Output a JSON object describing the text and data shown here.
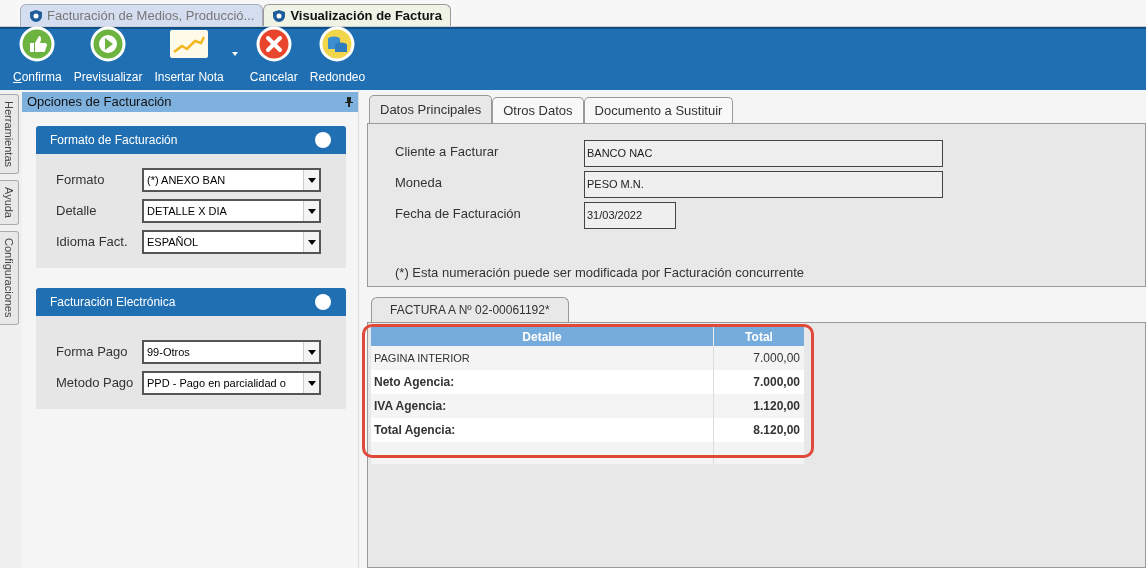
{
  "document_tabs": [
    {
      "label": "Facturación de Medios, Producció...",
      "selected": false
    },
    {
      "label": "Visualización de Factura",
      "selected": true
    }
  ],
  "toolbar": [
    {
      "kind": "confirm",
      "label": "Confirma",
      "mnemonic": true,
      "dropdown": false
    },
    {
      "kind": "preview",
      "label": "Previsualizar",
      "mnemonic": false,
      "dropdown": false
    },
    {
      "kind": "note",
      "label": "Insertar Nota",
      "mnemonic": false,
      "dropdown": true
    },
    {
      "kind": "cancel",
      "label": "Cancelar",
      "mnemonic": false,
      "dropdown": false
    },
    {
      "kind": "round",
      "label": "Redondeo",
      "mnemonic": false,
      "dropdown": false
    }
  ],
  "side_tabs": [
    "Herramientas",
    "Ayuda",
    "Configuraciones"
  ],
  "panel": {
    "title": "Opciones de Facturación",
    "groups": [
      {
        "title": "Formato de Facturación",
        "fields": [
          {
            "label": "Formato",
            "value": "(*) ANEXO BAN"
          },
          {
            "label": "Detalle",
            "value": "DETALLE X DIA"
          },
          {
            "label": "Idioma Fact.",
            "value": "ESPAÑOL"
          }
        ]
      },
      {
        "title": "Facturación Electrónica",
        "fields": [
          {
            "label": "Forma Pago",
            "value": "99-Otros"
          },
          {
            "label": "Metodo Pago",
            "value": "PPD - Pago en parcialidad o"
          }
        ]
      }
    ]
  },
  "main_tabs": [
    {
      "label": "Datos Principales",
      "selected": true
    },
    {
      "label": "Otros Datos",
      "selected": false
    },
    {
      "label": "Documento a Sustituir",
      "selected": false
    }
  ],
  "form": [
    {
      "label": "Cliente a Facturar",
      "value": "BANCO NAC",
      "kind": "wide"
    },
    {
      "label": "Moneda",
      "value": "PESO M.N.",
      "kind": "wide"
    },
    {
      "label": "Fecha de Facturación",
      "value": "31/03/2022",
      "kind": "short"
    }
  ],
  "note": "(*) Esta numeración puede ser modificada por Facturación concurrente",
  "invoice_tab": "FACTURA A Nº 02-00061192*",
  "table": {
    "columns": [
      "Detalle",
      "Total"
    ],
    "rows": [
      {
        "kind": "item",
        "detail": "PAGINA INTERIOR",
        "total": "7.000,00"
      },
      {
        "kind": "summary",
        "detail": "Neto Agencia:",
        "total": "7.000,00"
      },
      {
        "kind": "summary",
        "detail": "IVA Agencia:",
        "total": "1.120,00"
      },
      {
        "kind": "summary",
        "detail": "Total Agencia:",
        "total": "8.120,00"
      }
    ]
  }
}
